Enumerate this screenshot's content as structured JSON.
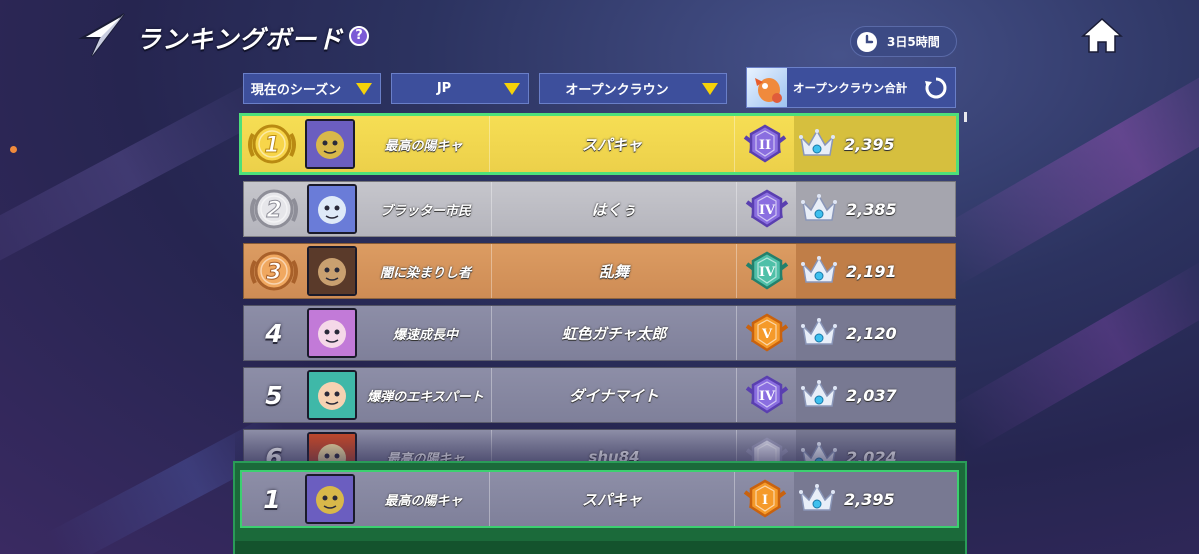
{
  "header": {
    "title": "ランキングボード",
    "help_label": "?",
    "timer": "3日5時間"
  },
  "filters": {
    "season": "現在のシーズン",
    "region": "JP",
    "mode": "オープンクラウン",
    "stat": "オープンクラウン合計"
  },
  "colors": {
    "gold_row": "#f0d64e",
    "silver_row": "#bdbdc4",
    "bronze_row": "#d4925b",
    "plain_row": "#8586a0",
    "highlight_border": "#4ee07a",
    "filter_arrow": "#f5d20a",
    "my_rank_panel": "#1b6a3a"
  },
  "rows": [
    {
      "rank": "1",
      "medal": "gold-medal-icon",
      "guild": "最高の陽キャ",
      "player": "スパキャ",
      "tier": "II",
      "tier_color": "purple",
      "score": "2,395"
    },
    {
      "rank": "2",
      "medal": "silver-medal-icon",
      "guild": "ブラッター市民",
      "player": "はくぅ",
      "tier": "IV",
      "tier_color": "purple",
      "score": "2,385"
    },
    {
      "rank": "3",
      "medal": "bronze-medal-icon",
      "guild": "闇に染まりし者",
      "player": "乱舞",
      "tier": "IV",
      "tier_color": "teal",
      "score": "2,191"
    },
    {
      "rank": "4",
      "guild": "爆速成長中",
      "player": "虹色ガチャ太郎",
      "tier": "V",
      "tier_color": "orange",
      "score": "2,120"
    },
    {
      "rank": "5",
      "guild": "爆弾のエキスパート",
      "player": "ダイナマイト",
      "tier": "IV",
      "tier_color": "purple",
      "score": "2,037"
    },
    {
      "rank": "6",
      "guild": "最高の陽キャ",
      "player": "shu84",
      "tier": "",
      "tier_color": "silver",
      "score": "2,024"
    }
  ],
  "my_rank": {
    "rank": "1",
    "guild": "最高の陽キャ",
    "player": "スパキャ",
    "tier": "I",
    "tier_color": "orange",
    "score": "2,395"
  }
}
